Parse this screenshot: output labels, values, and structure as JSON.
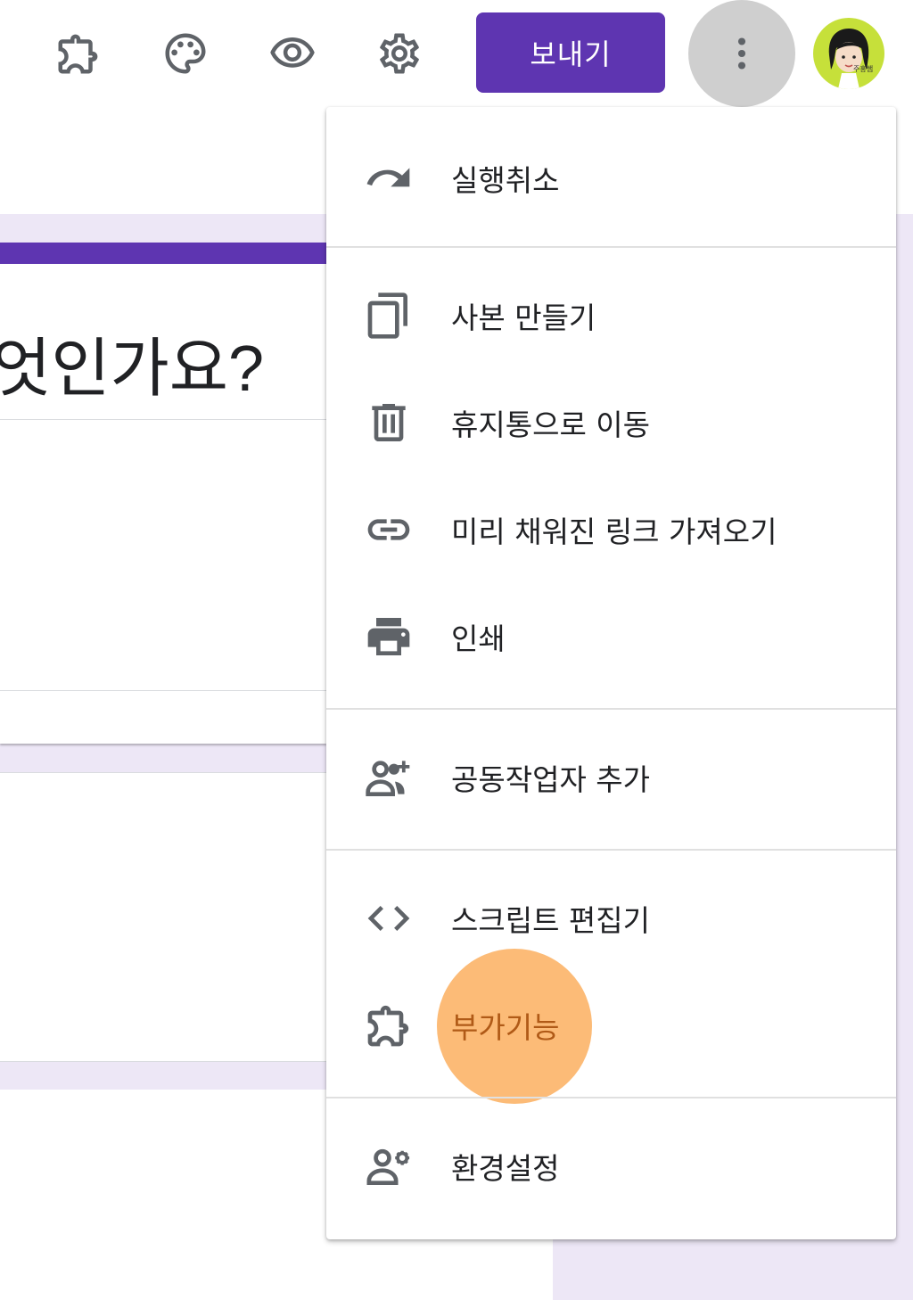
{
  "toolbar": {
    "icons": {
      "addons": "puzzle-icon",
      "theme": "palette-icon",
      "preview": "eye-icon",
      "settings": "gear-icon",
      "more": "more-vert-icon"
    },
    "send_label": "보내기",
    "avatar_caption": "주홍쌤"
  },
  "form": {
    "question_title_fragment": "엇인가요?"
  },
  "menu": {
    "items": [
      {
        "label": "실행취소",
        "icon": "undo-icon"
      },
      {
        "label": "사본 만들기",
        "icon": "copy-icon"
      },
      {
        "label": "휴지통으로 이동",
        "icon": "trash-icon"
      },
      {
        "label": "미리 채워진 링크 가져오기",
        "icon": "link-icon"
      },
      {
        "label": "인쇄",
        "icon": "print-icon"
      },
      {
        "label": "공동작업자 추가",
        "icon": "person-add-icon"
      },
      {
        "label": "스크립트 편집기",
        "icon": "code-icon"
      },
      {
        "label": "부가기능",
        "icon": "puzzle-icon"
      },
      {
        "label": "환경설정",
        "icon": "person-settings-icon"
      }
    ]
  },
  "colors": {
    "accent": "#5e35b1",
    "background_band": "#ede7f6",
    "highlight": "#fbaf5f",
    "icon_gray": "#5f6368",
    "avatar_bg": "#c6e03a"
  }
}
